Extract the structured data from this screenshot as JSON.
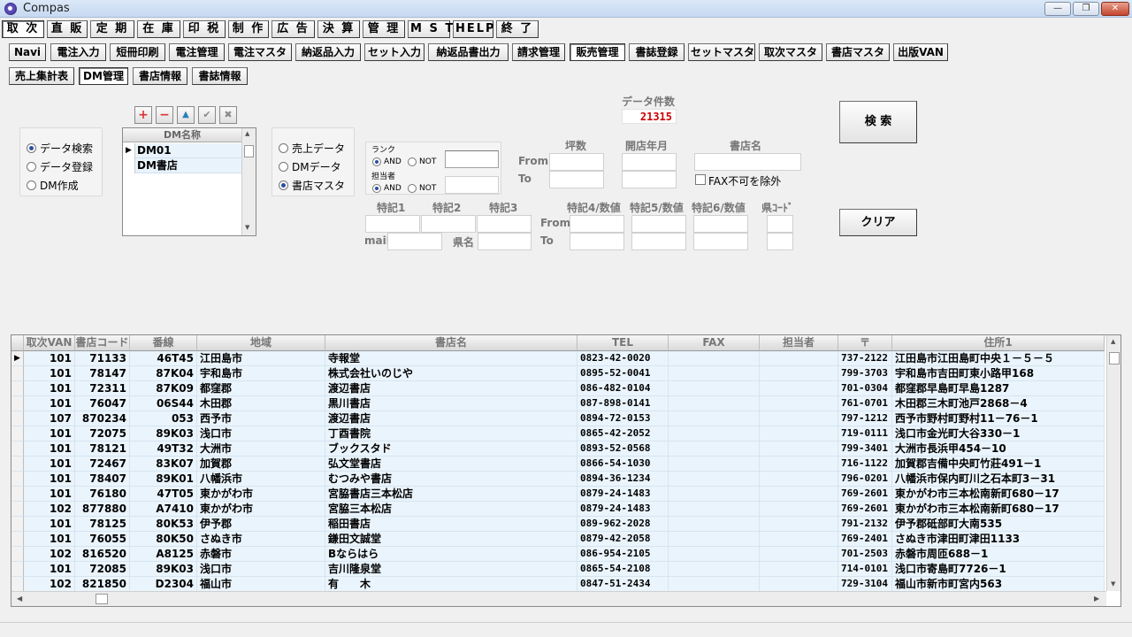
{
  "window": {
    "title": "Compas",
    "min": "—",
    "max": "❐",
    "close": "✕"
  },
  "menu": [
    "取 次",
    "直 販",
    "定 期",
    "在 庫",
    "印 税",
    "制 作",
    "広 告",
    "決 算",
    "管 理",
    "M S T",
    "HELP",
    "終 了"
  ],
  "submenu": [
    "Navi",
    "電注入力",
    "短冊印刷",
    "電注管理",
    "電注マスタ",
    "納返品入力",
    "セット入力",
    "納返品書出力",
    "請求管理",
    "販売管理",
    "書誌登録",
    "セットマスタ",
    "取次マスタ",
    "書店マスタ",
    "出版VAN"
  ],
  "tabs": [
    "売上集計表",
    "DM管理",
    "書店情報",
    "書誌情報"
  ],
  "mode": {
    "options": [
      "データ検索",
      "データ登録",
      "DM作成"
    ],
    "selected": 0
  },
  "tools": {
    "add": "+",
    "remove": "−",
    "up": "▲",
    "ok": "✔",
    "cancel": "✖"
  },
  "dm_list": {
    "header": "DM名称",
    "rows": [
      "DM01",
      "DM書店"
    ]
  },
  "source": {
    "options": [
      "売上データ",
      "DMデータ",
      "書店マスタ"
    ],
    "selected": 2
  },
  "count": {
    "label": "データ件数",
    "value": "21315"
  },
  "filters": {
    "rank_label": "ランク",
    "tantou_label": "担当者",
    "and": "AND",
    "not": "NOT",
    "tsubo": "坪数",
    "open_ym": "開店年月",
    "shop_name": "書店名",
    "from": "From",
    "to": "To",
    "fax_exclude": "FAX不可を除外",
    "tokki1": "特記1",
    "tokki2": "特記2",
    "tokki3": "特記3",
    "tokki4": "特記4/数値",
    "tokki5": "特記5/数値",
    "tokki6": "特記6/数値",
    "pref_code": "県ｺｰﾄﾞ",
    "mail": "mail",
    "pref_name": "県名"
  },
  "buttons": {
    "search": "検 索",
    "clear": "クリア"
  },
  "grid": {
    "columns": [
      "取次VAN",
      "書店コード",
      "番線",
      "地域",
      "書店名",
      "TEL",
      "FAX",
      "担当者",
      "〒",
      "住所1"
    ],
    "rows": [
      [
        "101",
        "71133",
        "46T45",
        "江田島市",
        "寺報堂",
        "0823-42-0020",
        "",
        "",
        "737-2122",
        "江田島市江田島町中央１－５－５"
      ],
      [
        "101",
        "78147",
        "87K04",
        "宇和島市",
        "株式会社いのじや",
        "0895-52-0041",
        "",
        "",
        "799-3703",
        "宇和島市吉田町東小路甲168"
      ],
      [
        "101",
        "72311",
        "87K09",
        "都窪郡",
        "渡辺書店",
        "086-482-0104",
        "",
        "",
        "701-0304",
        "都窪郡早島町早島1287"
      ],
      [
        "101",
        "76047",
        "06S44",
        "木田郡",
        "黒川書店",
        "087-898-0141",
        "",
        "",
        "761-0701",
        "木田郡三木町池戸2868－4"
      ],
      [
        "107",
        "870234",
        "053",
        "西予市",
        "渡辺書店",
        "0894-72-0153",
        "",
        "",
        "797-1212",
        "西予市野村町野村11－76－1"
      ],
      [
        "101",
        "72075",
        "89K03",
        "浅口市",
        "丁酉書院",
        "0865-42-2052",
        "",
        "",
        "719-0111",
        "浅口市金光町大谷330－1"
      ],
      [
        "101",
        "78121",
        "49T32",
        "大洲市",
        "ブックスタド",
        "0893-52-0568",
        "",
        "",
        "799-3401",
        "大洲市長浜甲454－10"
      ],
      [
        "101",
        "72467",
        "83K07",
        "加賀郡",
        "弘文堂書店",
        "0866-54-1030",
        "",
        "",
        "716-1122",
        "加賀郡吉備中央町竹莊491－1"
      ],
      [
        "101",
        "78407",
        "89K01",
        "八幡浜市",
        "むつみや書店",
        "0894-36-1234",
        "",
        "",
        "796-0201",
        "八幡浜市保内町川之石本町3－31"
      ],
      [
        "101",
        "76180",
        "47T05",
        "東かがわ市",
        "宮脇書店三本松店",
        "0879-24-1483",
        "",
        "",
        "769-2601",
        "東かがわ市三本松南新町680－17"
      ],
      [
        "102",
        "877880",
        "A7410",
        "東かがわ市",
        "宮脇三本松店",
        "0879-24-1483",
        "",
        "",
        "769-2601",
        "東かがわ市三本松南新町680－17"
      ],
      [
        "101",
        "78125",
        "80K53",
        "伊予郡",
        "稲田書店",
        "089-962-2028",
        "",
        "",
        "791-2132",
        "伊予郡砥部町大南535"
      ],
      [
        "101",
        "76055",
        "80K50",
        "さぬき市",
        "鎌田文誠堂",
        "0879-42-2058",
        "",
        "",
        "769-2401",
        "さぬき市津田町津田1133"
      ],
      [
        "102",
        "816520",
        "A8125",
        "赤磐市",
        "Bならはら",
        "086-954-2105",
        "",
        "",
        "701-2503",
        "赤磐市周匝688－1"
      ],
      [
        "101",
        "72085",
        "89K03",
        "浅口市",
        "吉川隆泉堂",
        "0865-54-2108",
        "",
        "",
        "714-0101",
        "浅口市寄島町7726－1"
      ],
      [
        "102",
        "821850",
        "D2304",
        "福山市",
        "有　　木",
        "0847-51-2434",
        "",
        "",
        "729-3104",
        "福山市新市町宮内563"
      ]
    ]
  }
}
